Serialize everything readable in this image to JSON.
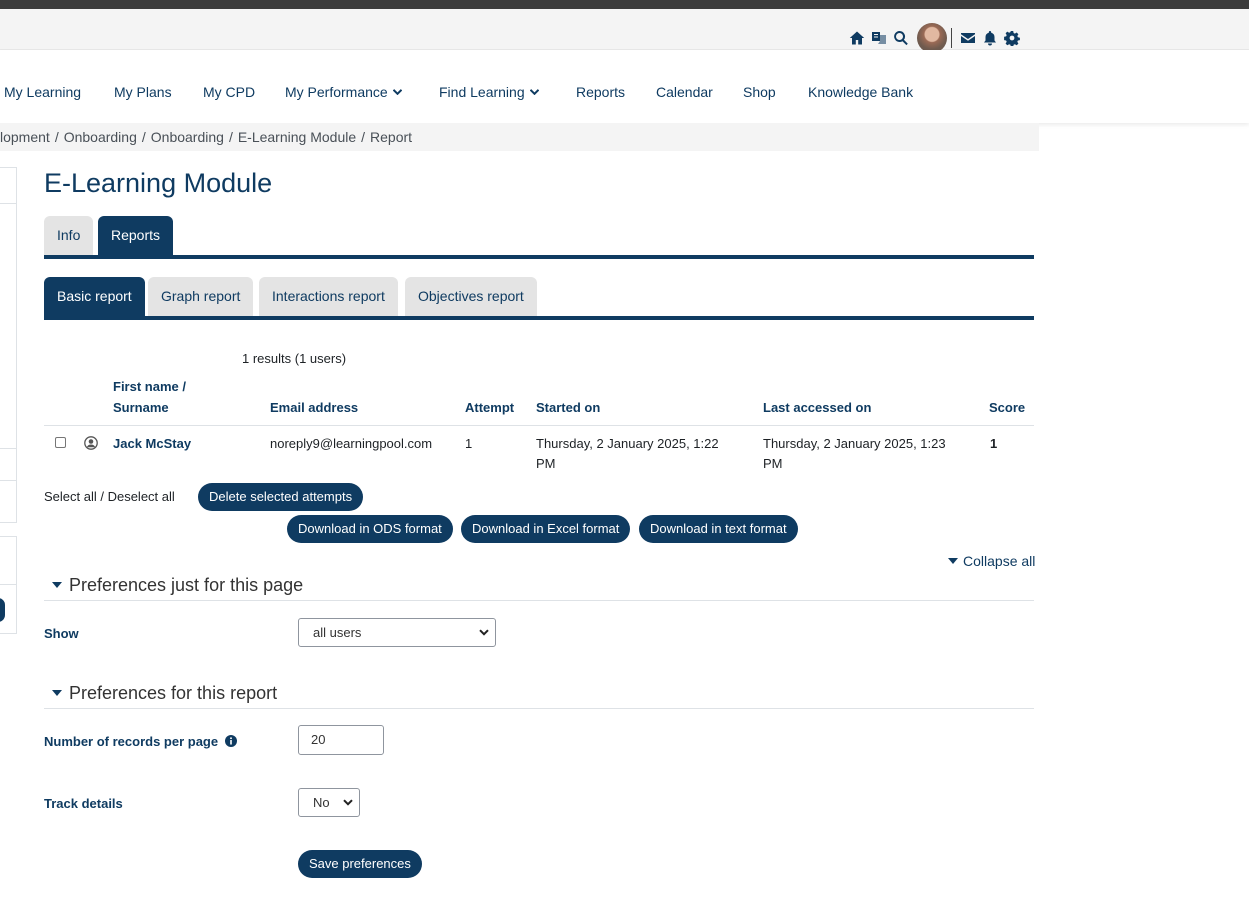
{
  "nav": {
    "items": [
      {
        "label": "My Learning"
      },
      {
        "label": "My Plans"
      },
      {
        "label": "My CPD"
      },
      {
        "label": "My Performance"
      },
      {
        "label": "Find Learning"
      },
      {
        "label": "Reports"
      },
      {
        "label": "Calendar"
      },
      {
        "label": "Shop"
      },
      {
        "label": "Knowledge Bank"
      }
    ]
  },
  "topbar": {
    "icons": [
      "home-icon",
      "language-icon",
      "search-icon",
      "user-avatar",
      "mail-icon",
      "bell-icon",
      "gear-icon"
    ]
  },
  "breadcrumb": [
    "lopment",
    "Onboarding",
    "Onboarding",
    "E-Learning Module",
    "Report"
  ],
  "page": {
    "title": "E-Learning Module"
  },
  "tabs": {
    "info": "Info",
    "reports": "Reports"
  },
  "subtabs": {
    "basic": "Basic report",
    "graph": "Graph report",
    "interactions": "Interactions report",
    "objectives": "Objectives report"
  },
  "report": {
    "results": "1 results (1 users)",
    "headers": {
      "name_line1": "First name /",
      "name_line2": "Surname",
      "email": "Email address",
      "attempt": "Attempt",
      "started": "Started on",
      "last_accessed": "Last accessed on",
      "score": "Score"
    },
    "rows": [
      {
        "name": "Jack McStay",
        "email": "noreply9@learningpool.com",
        "attempt": "1",
        "started_line1": "Thursday, 2 January 2025, 1:22",
        "started_line2": "PM",
        "last_line1": "Thursday, 2 January 2025, 1:23",
        "last_line2": "PM",
        "score": "1"
      }
    ],
    "select_all": "Select all / Deselect all",
    "delete_button": "Delete selected attempts",
    "download_ods": "Download in ODS format",
    "download_excel": "Download in Excel format",
    "download_text": "Download in text format"
  },
  "prefs": {
    "collapse_all": "Collapse all",
    "section1": "Preferences just for this page",
    "show_label": "Show",
    "show_value": "all users",
    "section2": "Preferences for this report",
    "records_label": "Number of records per page",
    "records_value": "20",
    "track_label": "Track details",
    "track_value": "No",
    "save_button": "Save preferences"
  },
  "colors": {
    "brand": "#0f3b61",
    "tab_inactive": "#e4e4e4",
    "topbar_bg": "#f4f4f4"
  }
}
